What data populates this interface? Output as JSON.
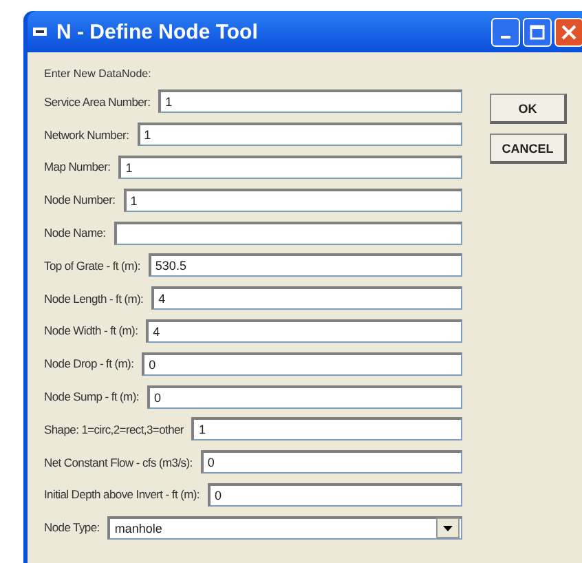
{
  "window": {
    "title": "N - Define Node Tool"
  },
  "heading": "Enter New DataNode:",
  "fields": [
    {
      "label": "Service Area Number:",
      "value": "1",
      "kind": "text"
    },
    {
      "label": "Network Number:",
      "value": "1",
      "kind": "text"
    },
    {
      "label": "Map Number:",
      "value": "1",
      "kind": "text"
    },
    {
      "label": "Node Number:",
      "value": "1",
      "kind": "text"
    },
    {
      "label": "Node Name:",
      "kind": "text"
    },
    {
      "label": "Top of Grate - ft (m):",
      "value": "530.5",
      "kind": "text"
    },
    {
      "label": "Node Length - ft (m):",
      "value": "4",
      "kind": "text"
    },
    {
      "label": "Node Width - ft (m):",
      "value": "4",
      "kind": "text"
    },
    {
      "label": "Node Drop - ft (m):",
      "value": "0",
      "kind": "text"
    },
    {
      "label": "Node Sump - ft (m):",
      "value": "0",
      "kind": "text"
    },
    {
      "label": "Shape: 1=circ,2=rect,3=other",
      "value": "1",
      "kind": "text"
    },
    {
      "label": "Net Constant Flow - cfs (m3/s):",
      "value": "0",
      "kind": "text"
    },
    {
      "label": "Initial Depth above Invert - ft (m):",
      "value": "0",
      "kind": "text"
    },
    {
      "label": "Node Type:",
      "value": "manhole",
      "kind": "select"
    }
  ],
  "buttons": [
    "OK",
    "CANCEL"
  ]
}
